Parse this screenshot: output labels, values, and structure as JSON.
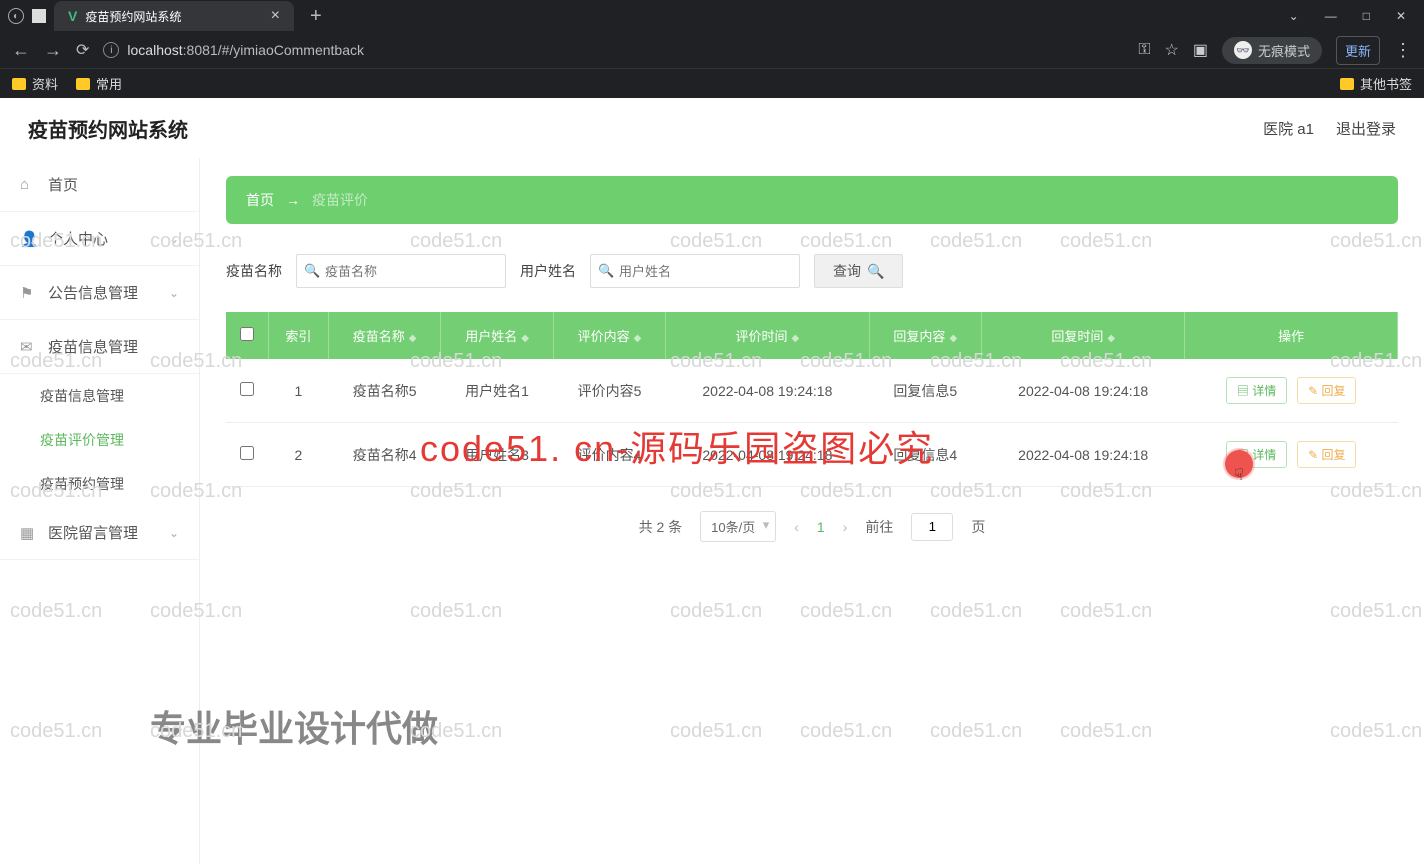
{
  "browser": {
    "tab_title": "疫苗预约网站系统",
    "url_host": "localhost",
    "url_rest": ":8081/#/yimiaoCommentback",
    "incognito_label": "无痕模式",
    "update_label": "更新",
    "bookmarks": [
      "资料",
      "常用"
    ],
    "bm_other": "其他书签"
  },
  "app": {
    "title": "疫苗预约网站系统",
    "user": "医院 a1",
    "logout": "退出登录"
  },
  "sidebar": {
    "home": "首页",
    "personal": "个人中心",
    "notice": "公告信息管理",
    "vaccine_info": "疫苗信息管理",
    "sub_info": "疫苗信息管理",
    "sub_comment": "疫苗评价管理",
    "sub_reserve": "疫苗预约管理",
    "hospital_msg": "医院留言管理"
  },
  "breadcrumb": {
    "home": "首页",
    "current": "疫苗评价"
  },
  "search": {
    "label1": "疫苗名称",
    "ph1": "疫苗名称",
    "label2": "用户姓名",
    "ph2": "用户姓名",
    "btn": "查询"
  },
  "table": {
    "headers": [
      "索引",
      "疫苗名称",
      "用户姓名",
      "评价内容",
      "评价时间",
      "回复内容",
      "回复时间",
      "操作"
    ],
    "rows": [
      {
        "idx": "1",
        "name": "疫苗名称5",
        "user": "用户姓名1",
        "comment": "评价内容5",
        "ctime": "2022-04-08 19:24:18",
        "reply": "回复信息5",
        "rtime": "2022-04-08 19:24:18"
      },
      {
        "idx": "2",
        "name": "疫苗名称4",
        "user": "用户姓名3",
        "comment": "评价内容4",
        "ctime": "2022-04-08 19:24:18",
        "reply": "回复信息4",
        "rtime": "2022-04-08 19:24:18"
      }
    ],
    "op_detail": "详情",
    "op_reply": "回复"
  },
  "pagination": {
    "total": "共 2 条",
    "per_page": "10条/页",
    "current": "1",
    "goto_prefix": "前往",
    "goto_val": "1",
    "goto_suffix": "页"
  },
  "watermark_text": "code51.cn",
  "big_red": "code51. cn-源码乐园盗图必究",
  "bottom_ad": "专业毕业设计代做"
}
